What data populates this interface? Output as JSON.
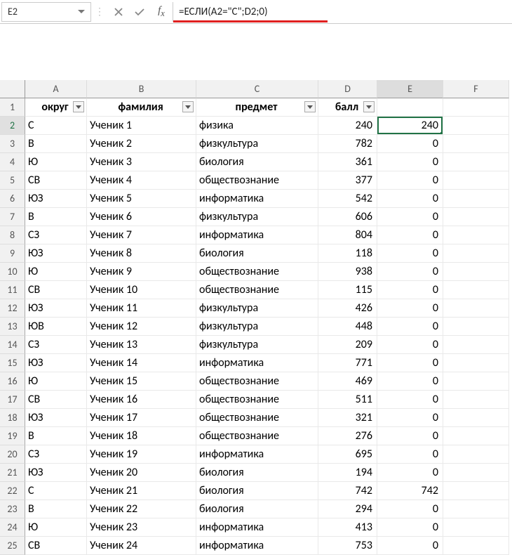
{
  "nameBox": "E2",
  "formula": "=ЕСЛИ(A2=\"С\";D2;0)",
  "columns": [
    "A",
    "B",
    "C",
    "D",
    "E",
    "F"
  ],
  "headers": {
    "A": "округ",
    "B": "фамилия",
    "C": "предмет",
    "D": "балл"
  },
  "activeCell": "E2",
  "rows": [
    {
      "n": 2,
      "a": "С",
      "b": "Ученик 1",
      "c": "физика",
      "d": 240,
      "e": 240
    },
    {
      "n": 3,
      "a": "В",
      "b": "Ученик 2",
      "c": "физкультура",
      "d": 782,
      "e": 0
    },
    {
      "n": 4,
      "a": "Ю",
      "b": "Ученик 3",
      "c": "биология",
      "d": 361,
      "e": 0
    },
    {
      "n": 5,
      "a": "СВ",
      "b": "Ученик 4",
      "c": "обществознание",
      "d": 377,
      "e": 0
    },
    {
      "n": 6,
      "a": "ЮЗ",
      "b": "Ученик 5",
      "c": "информатика",
      "d": 542,
      "e": 0
    },
    {
      "n": 7,
      "a": "В",
      "b": "Ученик 6",
      "c": "физкультура",
      "d": 606,
      "e": 0
    },
    {
      "n": 8,
      "a": "СЗ",
      "b": "Ученик 7",
      "c": "информатика",
      "d": 804,
      "e": 0
    },
    {
      "n": 9,
      "a": "ЮЗ",
      "b": "Ученик 8",
      "c": "биология",
      "d": 118,
      "e": 0
    },
    {
      "n": 10,
      "a": "Ю",
      "b": "Ученик 9",
      "c": "обществознание",
      "d": 938,
      "e": 0
    },
    {
      "n": 11,
      "a": "СВ",
      "b": "Ученик 10",
      "c": "обществознание",
      "d": 115,
      "e": 0
    },
    {
      "n": 12,
      "a": "ЮЗ",
      "b": "Ученик 11",
      "c": "физкультура",
      "d": 426,
      "e": 0
    },
    {
      "n": 13,
      "a": "ЮВ",
      "b": "Ученик 12",
      "c": "физкультура",
      "d": 448,
      "e": 0
    },
    {
      "n": 14,
      "a": "СЗ",
      "b": "Ученик 13",
      "c": "физкультура",
      "d": 209,
      "e": 0
    },
    {
      "n": 15,
      "a": "ЮЗ",
      "b": "Ученик 14",
      "c": "информатика",
      "d": 771,
      "e": 0
    },
    {
      "n": 16,
      "a": "Ю",
      "b": "Ученик 15",
      "c": "обществознание",
      "d": 469,
      "e": 0
    },
    {
      "n": 17,
      "a": "СВ",
      "b": "Ученик 16",
      "c": "обществознание",
      "d": 511,
      "e": 0
    },
    {
      "n": 18,
      "a": "ЮЗ",
      "b": "Ученик 17",
      "c": "обществознание",
      "d": 321,
      "e": 0
    },
    {
      "n": 19,
      "a": "В",
      "b": "Ученик 18",
      "c": "обществознание",
      "d": 276,
      "e": 0
    },
    {
      "n": 20,
      "a": "СЗ",
      "b": "Ученик 19",
      "c": "информатика",
      "d": 695,
      "e": 0
    },
    {
      "n": 21,
      "a": "ЮЗ",
      "b": "Ученик 20",
      "c": "биология",
      "d": 194,
      "e": 0
    },
    {
      "n": 22,
      "a": "С",
      "b": "Ученик 21",
      "c": "биология",
      "d": 742,
      "e": 742
    },
    {
      "n": 23,
      "a": "В",
      "b": "Ученик 22",
      "c": "биология",
      "d": 294,
      "e": 0
    },
    {
      "n": 24,
      "a": "Ю",
      "b": "Ученик 23",
      "c": "информатика",
      "d": 413,
      "e": 0
    },
    {
      "n": 25,
      "a": "СВ",
      "b": "Ученик 24",
      "c": "информатика",
      "d": 753,
      "e": 0
    }
  ]
}
